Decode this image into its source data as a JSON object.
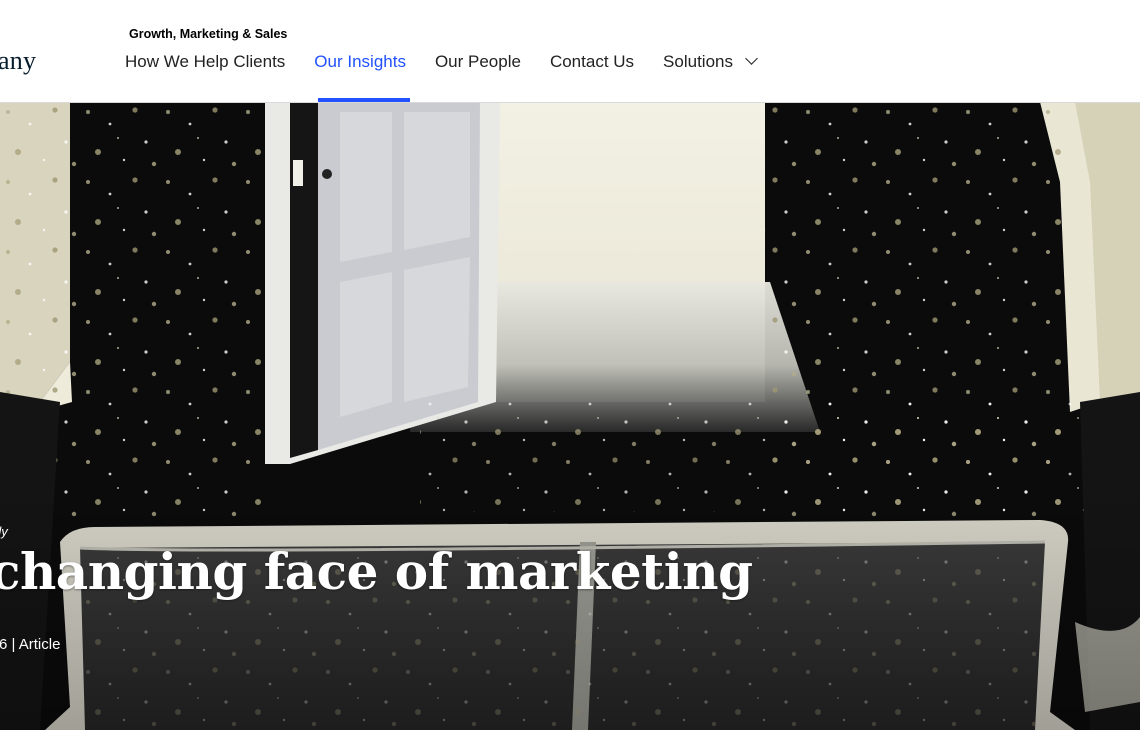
{
  "header": {
    "logo_text": "any",
    "section_label": "Growth, Marketing & Sales",
    "nav": [
      {
        "label": "How We Help Clients"
      },
      {
        "label": "Our Insights"
      },
      {
        "label": "Our People"
      },
      {
        "label": "Contact Us"
      },
      {
        "label": "Solutions"
      }
    ],
    "active_nav": "Our Insights"
  },
  "hero": {
    "eyebrow": "rly",
    "headline": "changing face of marketing",
    "meta": "6 | Article"
  },
  "colors": {
    "accent": "#2251ff",
    "ink": "#051c2c"
  }
}
